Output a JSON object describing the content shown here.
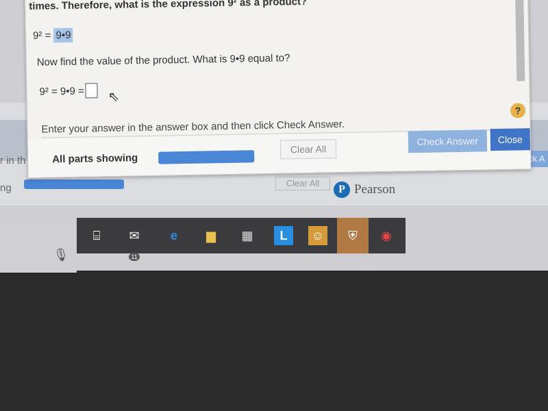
{
  "question": {
    "line1": "times. Therefore, what is the expression 9² as a product?",
    "eq1_lhs": "9² = ",
    "eq1_answer": "9•9",
    "line2": "Now find the value of the product. What is 9•9 equal to?",
    "eq2_lhs": "9² = 9•9 ="
  },
  "instruction": "Enter your answer in the answer box and then click Check Answer.",
  "footer": {
    "parts_label": "All parts showing",
    "clear_all": "Clear All",
    "check_answer": "Check Answer",
    "close": "Close",
    "help": "?"
  },
  "background": {
    "text1": "r in th",
    "text2": "ng",
    "clear_all": "Clear All",
    "check": "Check A",
    "brand": "Pearson",
    "brand_logo": "P"
  },
  "taskbar": {
    "mail_badge": "11",
    "icons": [
      "microphone-icon",
      "task-view-icon",
      "mail-icon",
      "edge-icon",
      "file-explorer-icon",
      "store-icon",
      "l-app-icon",
      "app-icon",
      "security-icon",
      "chrome-icon"
    ]
  },
  "colors": {
    "accent": "#3f74c7",
    "check_answer": "#8fb3df",
    "highlight": "#a8c3e8"
  }
}
